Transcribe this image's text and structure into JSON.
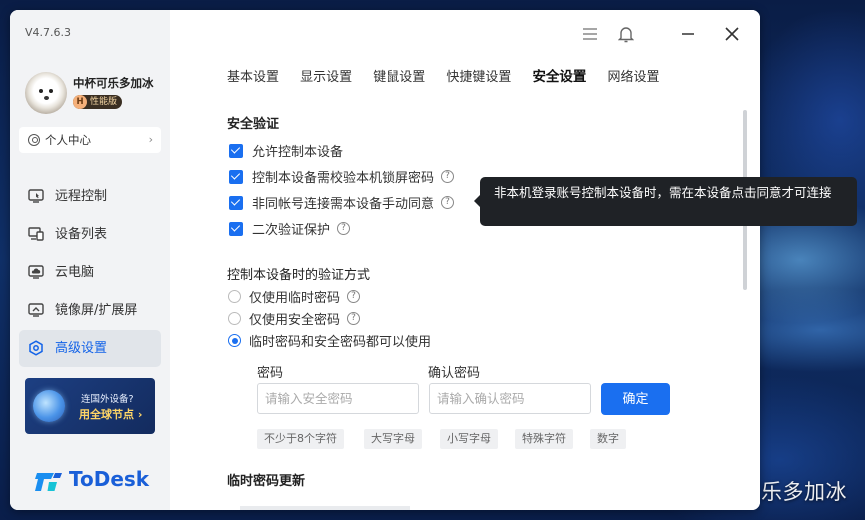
{
  "app": {
    "version": "V4.7.6.3",
    "logo_text": "ToDesk"
  },
  "user": {
    "name": "中杯可乐多加冰",
    "badge_letter": "H",
    "badge_text": "性能版",
    "personal_center": "个人中心"
  },
  "sidebar": {
    "items": [
      {
        "label": "远程控制",
        "icon": "remote-control-icon"
      },
      {
        "label": "设备列表",
        "icon": "device-list-icon"
      },
      {
        "label": "云电脑",
        "icon": "cloud-pc-icon"
      },
      {
        "label": "镜像屏/扩展屏",
        "icon": "mirror-screen-icon"
      },
      {
        "label": "高级设置",
        "icon": "advanced-settings-icon",
        "active": true
      }
    ],
    "promo_line1": "连国外设备?",
    "promo_line2": "用全球节点 ›"
  },
  "tabs": [
    {
      "label": "基本设置"
    },
    {
      "label": "显示设置"
    },
    {
      "label": "键鼠设置"
    },
    {
      "label": "快捷键设置"
    },
    {
      "label": "安全设置",
      "active": true
    },
    {
      "label": "网络设置"
    }
  ],
  "security": {
    "title": "安全验证",
    "checkboxes": [
      {
        "label": "允许控制本设备",
        "checked": true,
        "help": false
      },
      {
        "label": "控制本设备需校验本机锁屏密码",
        "checked": true,
        "help": true
      },
      {
        "label": "非同帐号连接需本设备手动同意",
        "checked": true,
        "help": true
      },
      {
        "label": "二次验证保护",
        "checked": true,
        "help": true
      }
    ],
    "tooltip": "非本机登录账号控制本设备时，需在本设备点击同意才可连接"
  },
  "verify_method": {
    "title": "控制本设备时的验证方式",
    "options": [
      {
        "label": "仅使用临时密码",
        "selected": false
      },
      {
        "label": "仅使用安全密码",
        "selected": false
      },
      {
        "label": "临时密码和安全密码都可以使用",
        "selected": true
      }
    ]
  },
  "password": {
    "password_label": "密码",
    "password_placeholder": "请输入安全密码",
    "confirm_label": "确认密码",
    "confirm_placeholder": "请输入确认密码",
    "confirm_button": "确定",
    "hints": [
      "不少于8个字符",
      "大写字母",
      "小写字母",
      "特殊字符",
      "数字"
    ]
  },
  "temp_password": {
    "title": "临时密码更新"
  },
  "watermark": "掘金技术社区 @ 中杯可乐多加冰",
  "colors": {
    "accent": "#1a6ff0",
    "tooltip_bg": "#1f2226",
    "sidebar_bg": "#f2f3f5"
  }
}
